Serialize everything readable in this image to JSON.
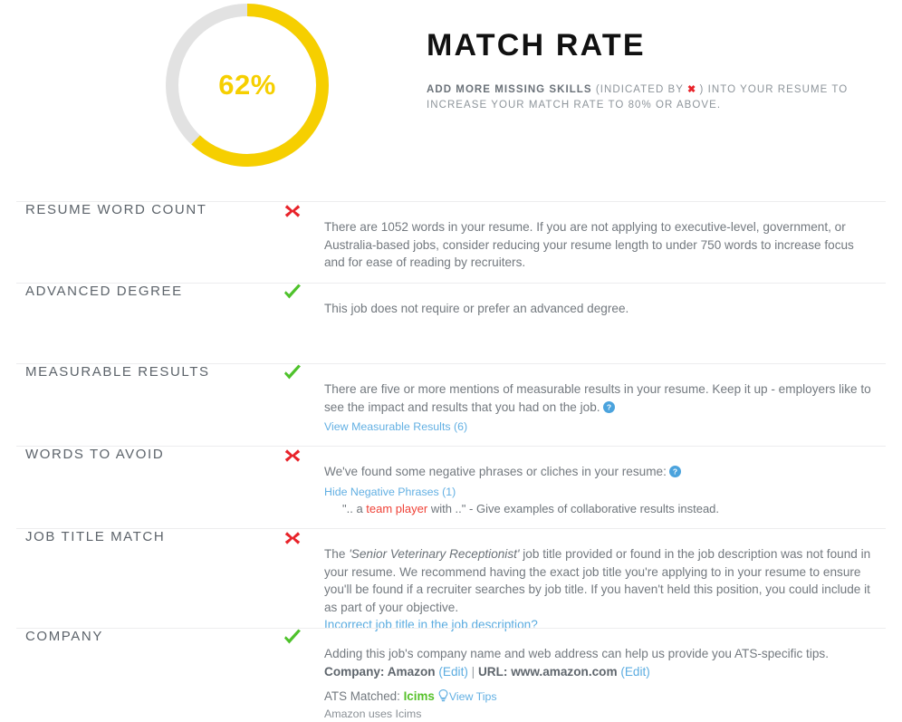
{
  "header": {
    "score_percent": "62%",
    "score_value": 62,
    "title": "MATCH RATE",
    "subtitle_strong": "ADD MORE MISSING SKILLS",
    "subtitle_rest_1": "(INDICATED BY",
    "subtitle_x": "✖",
    "subtitle_rest_2": ") INTO YOUR RESUME TO INCREASE YOUR MATCH RATE TO 80% OR ABOVE.",
    "ring_color": "#f6cf00",
    "track_color": "#e2e2e2"
  },
  "colors": {
    "fail": "#e8232a",
    "pass": "#56c12a",
    "link": "#5bace0",
    "accent": "#f6cf00"
  },
  "rows": {
    "word_count": {
      "label": "RESUME WORD COUNT",
      "status": "fail",
      "text": "There are 1052 words in your resume. If you are not applying to executive-level, government, or Australia-based jobs, consider reducing your resume length to under 750 words to increase focus and for ease of reading by recruiters."
    },
    "advanced_degree": {
      "label": "ADVANCED DEGREE",
      "status": "pass",
      "text": "This job does not require or prefer an advanced degree."
    },
    "measurable_results": {
      "label": "MEASURABLE RESULTS",
      "status": "pass",
      "text": "There are five or more mentions of measurable results in your resume. Keep it up - employers like to see the impact and results that you had on the job.",
      "link": "View Measurable Results (6)"
    },
    "words_to_avoid": {
      "label": "WORDS TO AVOID",
      "status": "fail",
      "text": "We've found some negative phrases or cliches in your resume:",
      "link": "Hide Negative Phrases (1)",
      "quote_pre": "\".. a ",
      "quote_highlight": "team player",
      "quote_post": " with ..\" - Give examples of collaborative results instead."
    },
    "job_title_match": {
      "label": "JOB TITLE MATCH",
      "status": "fail",
      "text_pre": "The ",
      "job_title": "'Senior Veterinary Receptionist'",
      "text_post": " job title provided or found in the job description was not found in your resume. We recommend having the exact job title you're applying to in your resume to ensure you'll be found if a recruiter searches by job title. If you haven't held this position, you could include it as part of your objective.",
      "link": "Incorrect job title in the job description?"
    },
    "company": {
      "label": "COMPANY",
      "status": "pass",
      "text": "Adding this job's company name and web address can help us provide you ATS-specific tips.",
      "company_label": "Company: Amazon",
      "company_edit": "(Edit)",
      "separator": "|",
      "url_label": "URL: www.amazon.com",
      "url_edit": "(Edit)",
      "ats_label": "ATS Matched: ",
      "ats_name": "Icims",
      "ats_tips": "View Tips",
      "ats_note": "Amazon uses Icims"
    }
  }
}
